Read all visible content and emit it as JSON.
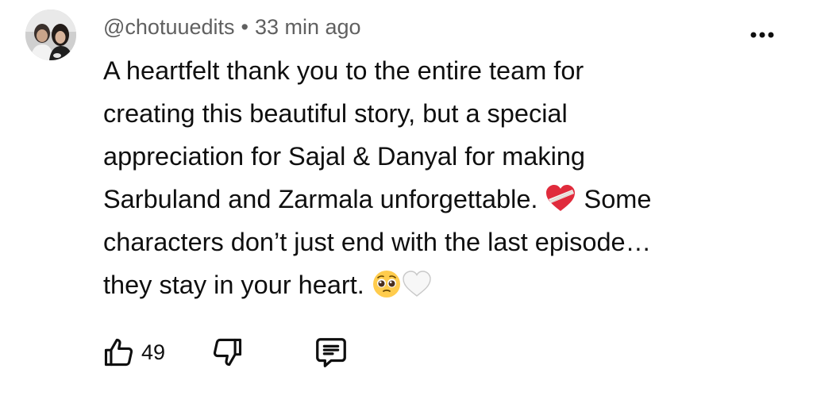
{
  "comment": {
    "author": "@chotuuedits",
    "separator": "•",
    "timestamp": "33 min ago",
    "text_lines": [
      "A heartfelt thank you to the entire team for",
      "creating this beautiful story, but a special",
      "appreciation for Sajal & Danyal for making",
      "Sarbuland and Zarmala unforgettable.",
      "Some",
      "characters don’t just end with the last episode…",
      "they stay in your heart."
    ],
    "emojis": [
      "mending-heart-emoji",
      "pleading-face-emoji",
      "white-heart-emoji"
    ],
    "like_count": "49"
  },
  "icons": {
    "more": "more-vertical-dots-icon",
    "like": "thumbs-up-icon",
    "dislike": "thumbs-down-icon",
    "reply": "comment-reply-icon"
  },
  "colors": {
    "text": "#0f0f0f",
    "meta": "#606060",
    "heart_red": "#e02b3c"
  }
}
